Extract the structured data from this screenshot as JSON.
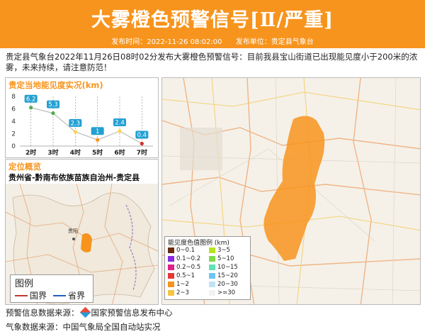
{
  "header": {
    "title": "大雾橙色预警信号[Ⅱ/严重]",
    "publish_time_label": "发布时间：2022-11-26 08:02:00",
    "publish_unit_label": "发布单位：贵定县气象台"
  },
  "description": "贵定县气象台2022年11月26日08时02分发布大雾橙色预警信号：目前我县宝山街道已出现能见度小于200米的浓雾，未来持续，请注意防范！",
  "visibility_panel": {
    "title": "贵定当地能见度实况(km)",
    "y_ticks": [
      "0",
      "2",
      "4",
      "6",
      "8"
    ]
  },
  "chart_data": {
    "type": "line",
    "title": "贵定当地能见度实况(km)",
    "categories": [
      "2时",
      "3时",
      "4时",
      "5时",
      "6时",
      "7时"
    ],
    "values": [
      6.2,
      5.3,
      2.3,
      1,
      2.4,
      0.4
    ],
    "value_labels": [
      "6.2",
      "5.3",
      "2.3",
      "1",
      "2.4",
      "0.4"
    ],
    "ylim": [
      0,
      8
    ],
    "point_colors": [
      "#4caf50",
      "#4caf50",
      "#ffd54f",
      "#f7941d",
      "#ffd54f",
      "#d32f2f"
    ]
  },
  "location_panel": {
    "title": "定位概览",
    "subtitle": "贵州省-黔南布依族苗族自治州-贵定县",
    "city_label": "贵阳",
    "legend_title": "图例",
    "legend_items": [
      {
        "label": "国界",
        "color": "#c0392b"
      },
      {
        "label": "省界",
        "color": "#1f5fbf"
      }
    ]
  },
  "visibility_legend": {
    "title": "能见度色值图例 (km)",
    "items": [
      {
        "label": "0~0.1",
        "color": "#6b2a10"
      },
      {
        "label": "0.1~0.2",
        "color": "#8a2be2"
      },
      {
        "label": "0.2~0.5",
        "color": "#e0218a"
      },
      {
        "label": "0.5~1",
        "color": "#e53935"
      },
      {
        "label": "1~2",
        "color": "#f7941d"
      },
      {
        "label": "2~3",
        "color": "#f4c542"
      },
      {
        "label": "3~5",
        "color": "#b5e61d"
      },
      {
        "label": "5~10",
        "color": "#7ddc4a"
      },
      {
        "label": "10~15",
        "color": "#5ee3b5"
      },
      {
        "label": "15~20",
        "color": "#6ec6f0"
      },
      {
        "label": "20~30",
        "color": "#bfe3f5"
      },
      {
        "label": ">=30",
        "color": "#f2f2f2"
      }
    ]
  },
  "footer": {
    "source1_label": "预警信息数据来源：",
    "source1_value": "国家预警信息发布中心",
    "source2": "气象数据来源：中国气象局全国自动站实况"
  },
  "colors": {
    "accent": "#f7941d",
    "fog_area": "#f7941d"
  }
}
